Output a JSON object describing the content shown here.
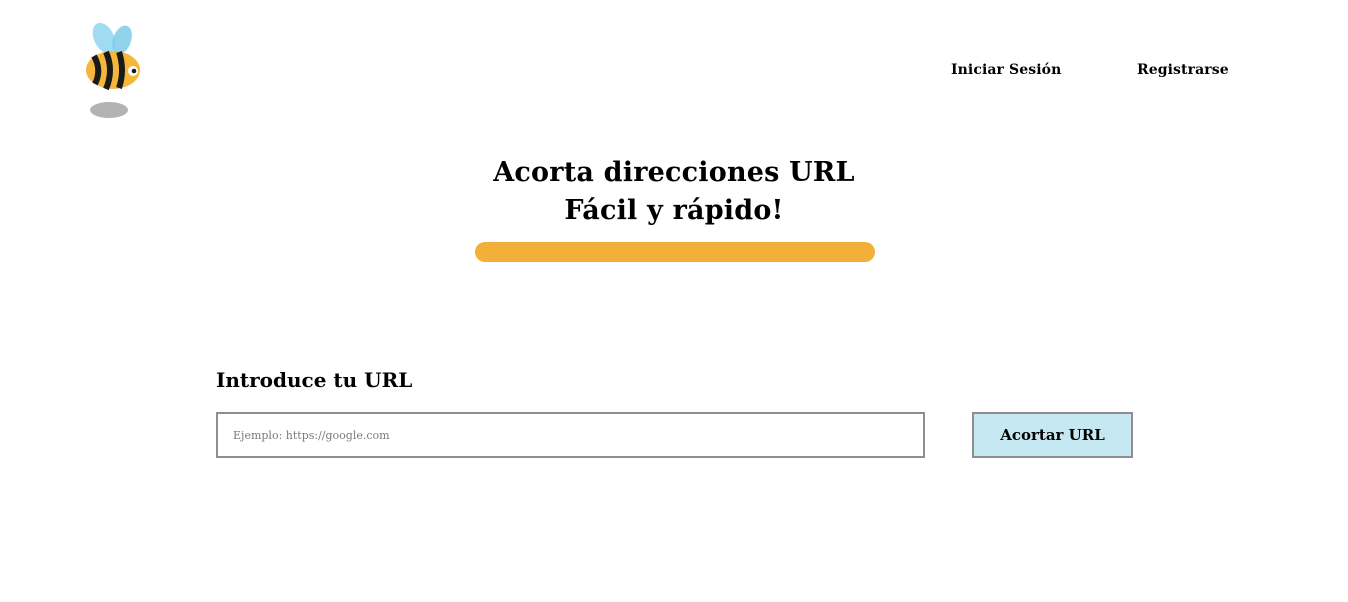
{
  "header": {
    "logo_icon": "bee-icon",
    "nav": {
      "login_label": "Iniciar Sesión",
      "register_label": "Registrarse"
    }
  },
  "hero": {
    "title_line1": "Acorta direcciones URL",
    "title_line2": "Fácil y rápido!"
  },
  "form": {
    "label": "Introduce tu URL",
    "url_placeholder": "Ejemplo: https://google.com",
    "url_value": "",
    "submit_label": "Acortar URL"
  },
  "colors": {
    "accent_bar": "#f2b038",
    "button_bg": "#c6e8f3",
    "border": "#8e8e8e",
    "bee_yellow": "#f5b73b",
    "bee_wing": "#8fd6ee"
  }
}
